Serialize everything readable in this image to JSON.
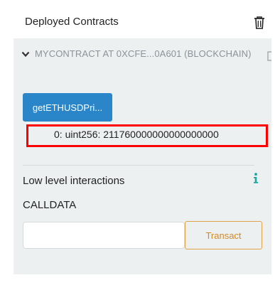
{
  "header": {
    "title": "Deployed Contracts",
    "trash_icon": "trash-icon"
  },
  "contract": {
    "label": "MYCONTRACT AT 0XCFE...0A601 (BLOCKCHAIN)",
    "expanded": true,
    "chevron_icon": "chevron-down-icon",
    "copy_icon": "copy-icon",
    "function_button_label": "getETHUSDPri...",
    "result_text": "0: uint256: 211760000000000000000"
  },
  "low_level": {
    "title": "Low level interactions",
    "info_icon": "info-icon",
    "calldata_label": "CALLDATA",
    "calldata_value": "",
    "transact_label": "Transact"
  },
  "colors": {
    "panel_bg": "#edf0f1",
    "button_blue": "#2a86c8",
    "highlight_red": "#ff0000",
    "transact_orange": "#e0a24a",
    "info_teal": "#1aa8a0"
  }
}
